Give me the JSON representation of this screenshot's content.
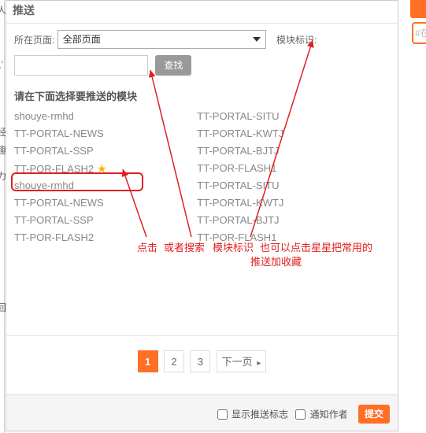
{
  "left_sliver_chars": [
    "人",
    "','",
    "经",
    "趣",
    "力",
    "",
    "",
    "",
    "回"
  ],
  "dialog": {
    "title": "推送",
    "page_label": "所在页面:",
    "page_select_value": "全部页面",
    "module_label": "模块标识:",
    "search_placeholder": "",
    "search_button": "查找",
    "instruction": "请在下面选择要推送的模块",
    "modules_left": [
      "shouye-rmhd",
      "TT-PORTAL-NEWS",
      "TT-PORTAL-SSP",
      "TT-POR-FLASH2",
      "shouye-rmhd",
      "TT-PORTAL-NEWS",
      "TT-PORTAL-SSP",
      "TT-POR-FLASH2"
    ],
    "modules_right": [
      "TT-PORTAL-SITU",
      "TT-PORTAL-KWTJ",
      "TT-PORTAL-BJTJ",
      "TT-POR-FLASH1",
      "TT-PORTAL-SITU",
      "TT-PORTAL-KWTJ",
      "TT-PORTAL-BJTJ",
      "TT-POR-FLASH1"
    ],
    "highlight_index": 3
  },
  "annotation": {
    "line1_a": "点击",
    "line1_b": "或者搜索",
    "line1_c": "模块标识",
    "line1_d": "也可以点击星星把常用的",
    "line2": "推送加收藏"
  },
  "pagination": {
    "pages": [
      "1",
      "2",
      "3"
    ],
    "next": "下一页",
    "active_index": 0
  },
  "footer": {
    "show_flag": "显示推送标志",
    "notify_author": "通知作者",
    "submit": "提交"
  },
  "right_tag_placeholder": "#在",
  "colors": {
    "accent": "#ff6f26",
    "annotation_red": "#e02020"
  }
}
